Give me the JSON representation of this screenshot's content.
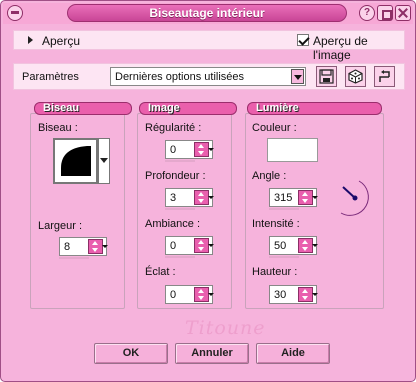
{
  "window": {
    "title": "Biseautage intérieur"
  },
  "preview": {
    "label": "Aperçu",
    "show_image_label": "Aperçu de l'image",
    "show_image_checked": true
  },
  "params": {
    "label": "Paramètres",
    "preset_value": "Dernières options utilisées"
  },
  "biseau": {
    "group_title": "Biseau",
    "shape_label": "Biseau :",
    "width_label": "Largeur :",
    "width_value": "8"
  },
  "image": {
    "group_title": "Image",
    "regularity_label": "Régularité :",
    "regularity_value": "0",
    "depth_label": "Profondeur :",
    "depth_value": "3",
    "ambiance_label": "Ambiance :",
    "ambiance_value": "0",
    "shine_label": "Éclat :",
    "shine_value": "0"
  },
  "lumiere": {
    "group_title": "Lumière",
    "color_label": "Couleur :",
    "color_value": "#ffffff",
    "angle_label": "Angle :",
    "angle_value": "315",
    "intensity_label": "Intensité :",
    "intensity_value": "50",
    "height_label": "Hauteur :",
    "height_value": "30"
  },
  "watermark": "Titoune",
  "buttons": {
    "ok": "OK",
    "cancel": "Annuler",
    "help": "Aide"
  },
  "colors": {
    "window_bg": "#f6b3dc",
    "accent": "#e95fae",
    "panel_bg": "#fde5f3"
  },
  "icons": {
    "menu": "menu-icon",
    "help": "help-icon",
    "minimize": "minimize-icon",
    "close": "close-icon",
    "save": "save-icon",
    "random": "dice-icon",
    "reset": "reset-icon"
  }
}
